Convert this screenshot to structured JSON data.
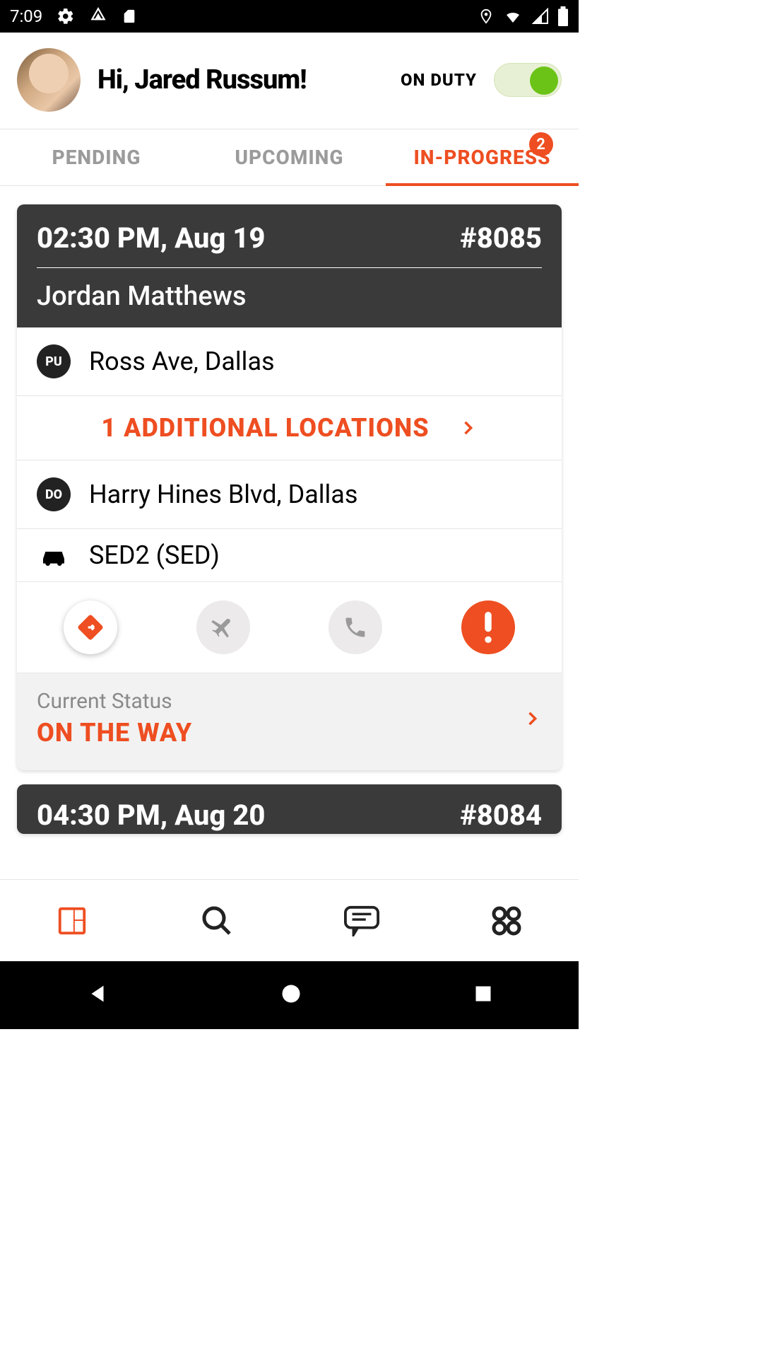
{
  "statusbar": {
    "time": "7:09"
  },
  "header": {
    "greeting": "Hi, Jared Russum!",
    "duty_label": "ON DUTY",
    "duty_on": true
  },
  "tabs": {
    "pending": "PENDING",
    "upcoming": "UPCOMING",
    "inprogress": "IN-PROGRESS",
    "inprogress_badge": "2",
    "active": "inprogress"
  },
  "cards": [
    {
      "time": "02:30 PM, Aug 19",
      "id": "#8085",
      "customer": "Jordan Matthews",
      "pickup_tag": "PU",
      "pickup_addr": "Ross Ave, Dallas",
      "addl_label": "1 ADDITIONAL LOCATIONS",
      "dropoff_tag": "DO",
      "dropoff_addr": "Harry Hines Blvd, Dallas",
      "vehicle": "SED2 (SED)",
      "status_title": "Current Status",
      "status_value": "ON THE WAY"
    },
    {
      "time": "04:30 PM, Aug 20",
      "id": "#8084"
    }
  ],
  "colors": {
    "accent": "#ee4e21",
    "toggle_on": "#6cc317"
  }
}
